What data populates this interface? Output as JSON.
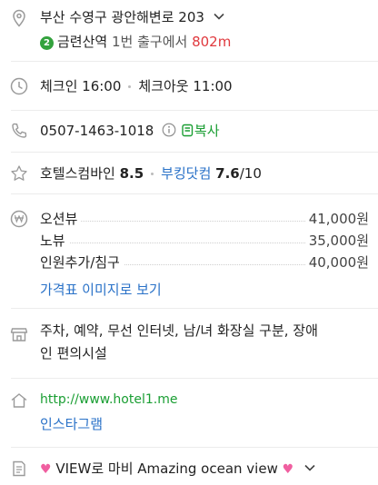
{
  "address": {
    "text": "부산 수영구 광안해변로 203",
    "subway": {
      "line": "2",
      "station": "금련산역",
      "exit": "1번 출구에서",
      "distance": "802m"
    }
  },
  "hours": {
    "checkin": "체크인 16:00",
    "checkout": "체크아웃 11:00"
  },
  "phone": {
    "number": "0507-1463-1018",
    "copy_label": "복사"
  },
  "ratings": {
    "source1": "호텔스컴바인",
    "score1": "8.5",
    "source2": "부킹닷컴",
    "score2": "7.6",
    "score2_max": "/10"
  },
  "prices": {
    "items": [
      {
        "name": "오션뷰",
        "price": "41,000원"
      },
      {
        "name": "노뷰",
        "price": "35,000원"
      },
      {
        "name": "인원추가/침구",
        "price": "40,000원"
      }
    ],
    "image_link": "가격표 이미지로 보기"
  },
  "facilities": {
    "line1": "주차, 예약, 무선 인터넷, 남/녀 화장실 구분, 장애",
    "line2": "인 편의시설"
  },
  "homepage": {
    "url": "http://www.hotel1.me",
    "instagram": "인스타그램"
  },
  "description": {
    "text": "VIEW로 마비 Amazing ocean view"
  },
  "colors": {
    "blue": "#2a72c8",
    "green": "#1a9e33",
    "red": "#e0393e",
    "subway_line2": "#33a23d",
    "heart": "#f05fa0"
  }
}
